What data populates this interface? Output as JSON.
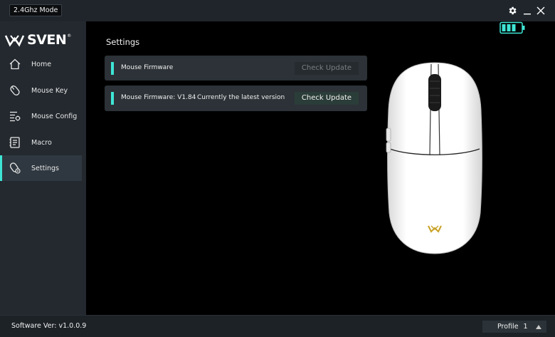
{
  "titlebar": {
    "mode": "2.4Ghz Mode",
    "icons": [
      "gear-icon",
      "minimize-icon",
      "close-icon"
    ]
  },
  "sidebar": {
    "logo": {
      "text": "SVEN",
      "reg": "®",
      "icon": "sven-logo-icon"
    },
    "items": [
      {
        "label": "Home",
        "icon": "home-icon",
        "active": false
      },
      {
        "label": "Mouse Key",
        "icon": "mouse-key-icon",
        "active": false
      },
      {
        "label": "Mouse Config",
        "icon": "config-icon",
        "active": false
      },
      {
        "label": "Macro",
        "icon": "macro-icon",
        "active": false
      },
      {
        "label": "Settings",
        "icon": "settings-gear-icon",
        "active": true
      }
    ]
  },
  "main": {
    "title": "Settings",
    "battery": {
      "icon": "battery-icon",
      "level": 0.75
    },
    "rows": [
      {
        "label": "Mouse Firmware",
        "status": "",
        "button": "Check Update",
        "enabled": false
      },
      {
        "label": "Mouse Firmware: V1.84",
        "status": "Currently the latest version",
        "button": "Check Update",
        "enabled": true
      }
    ]
  },
  "footer": {
    "software_version": "Software Ver: v1.0.0.9",
    "profile_label": "Profile",
    "profile_number": "1"
  },
  "colors": {
    "accent": "#3ee5d5",
    "logo_gold": "#c9a227"
  }
}
